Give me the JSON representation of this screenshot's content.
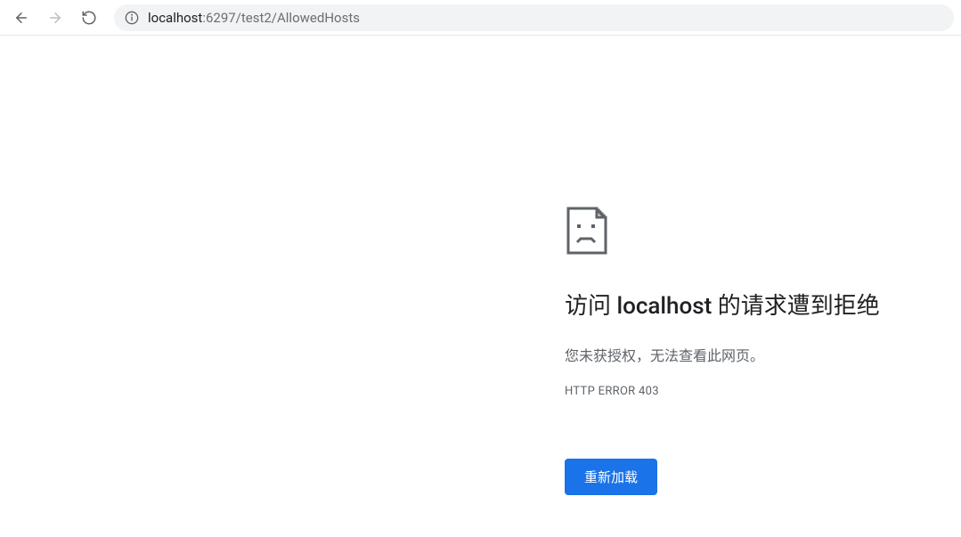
{
  "toolbar": {
    "url_host": "localhost",
    "url_rest": ":6297/test2/AllowedHosts"
  },
  "error": {
    "title_prefix": "访问 ",
    "title_host": "localhost",
    "title_suffix": " 的请求遭到拒绝",
    "subtitle": "您未获授权，无法查看此网页。",
    "code": "HTTP ERROR 403",
    "reload_label": "重新加载"
  }
}
